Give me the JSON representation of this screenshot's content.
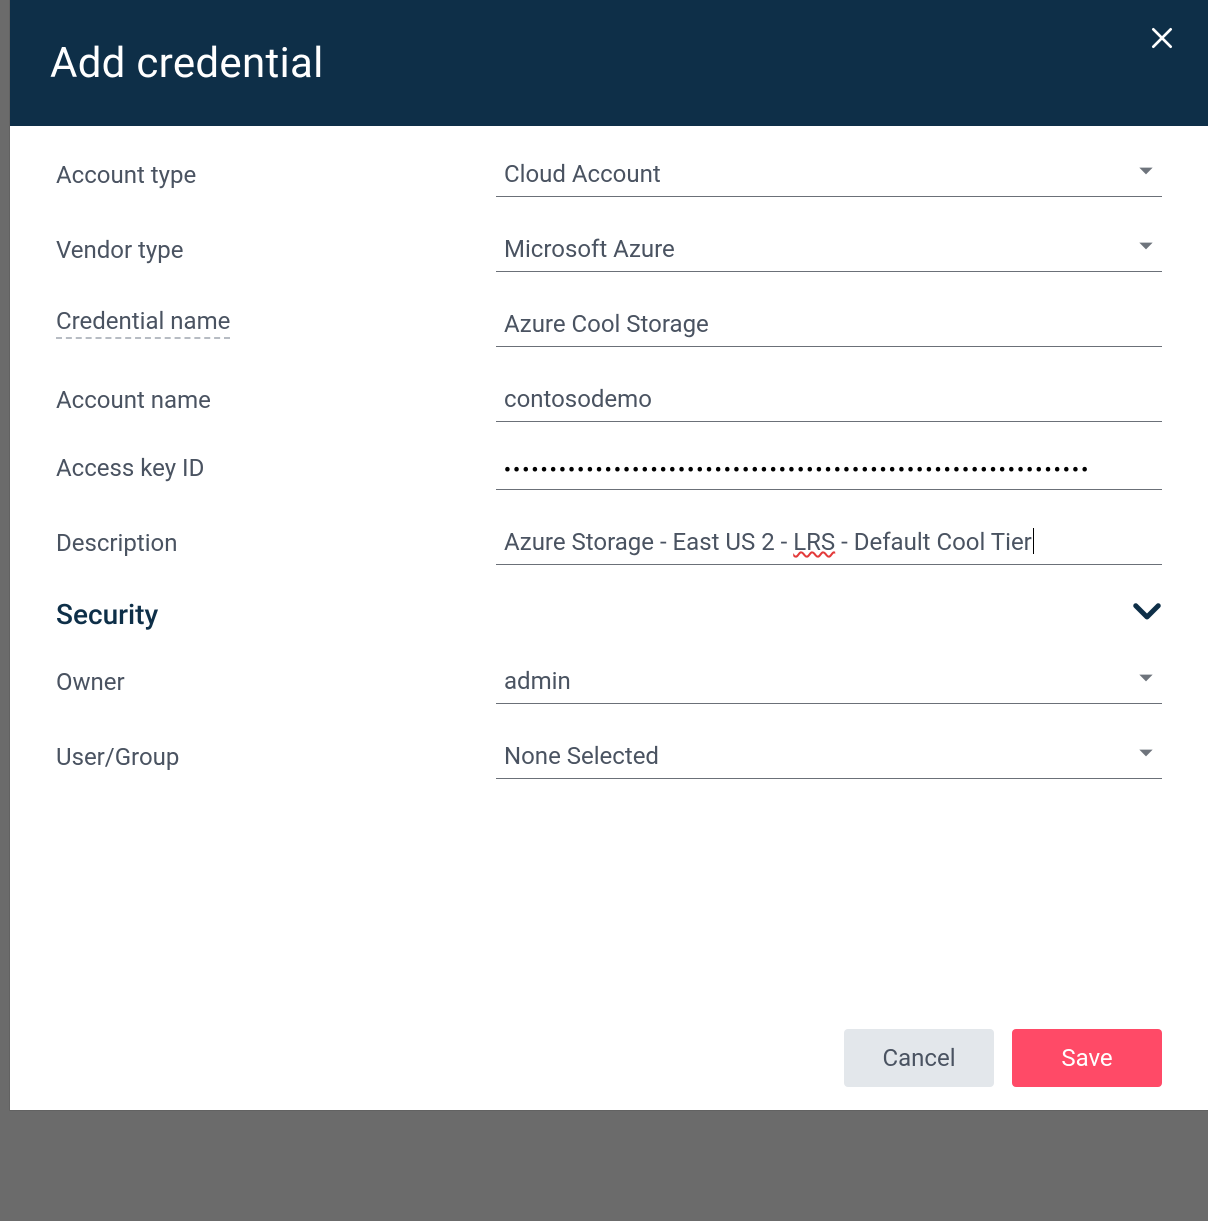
{
  "header": {
    "title": "Add credential"
  },
  "fields": {
    "accountType": {
      "label": "Account type",
      "value": "Cloud Account"
    },
    "vendorType": {
      "label": "Vendor type",
      "value": "Microsoft Azure"
    },
    "credentialName": {
      "label": "Credential name",
      "value": "Azure Cool Storage"
    },
    "accountName": {
      "label": "Account name",
      "value": "contosodemo"
    },
    "accessKeyId": {
      "label": "Access key ID",
      "value": "••••••••••••••••••••••••••••••••••••••••••••••••••••••••••••••••"
    },
    "description": {
      "label": "Description",
      "value_prefix": "Azure Storage - East US 2 - ",
      "value_spell": "LRS",
      "value_suffix": " - Default Cool Tier"
    }
  },
  "sections": {
    "security": {
      "title": "Security"
    }
  },
  "security": {
    "owner": {
      "label": "Owner",
      "value": "admin"
    },
    "userGroup": {
      "label": "User/Group",
      "value": "None Selected"
    }
  },
  "footer": {
    "cancel": "Cancel",
    "save": "Save"
  }
}
